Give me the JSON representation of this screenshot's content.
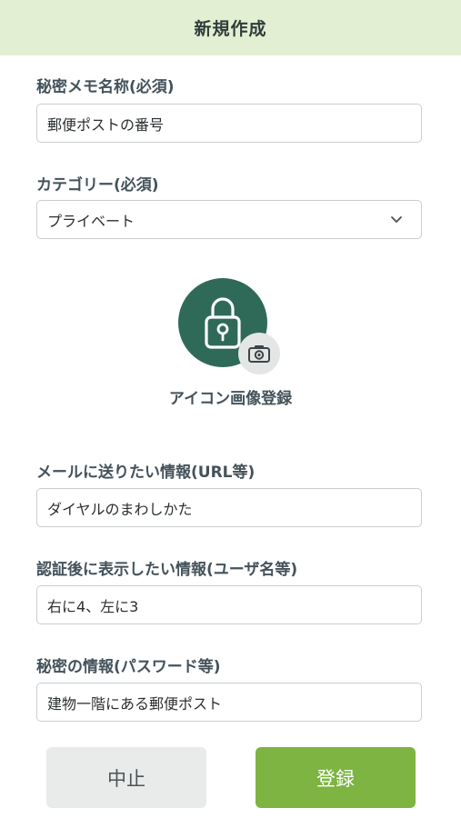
{
  "header": {
    "title": "新規作成",
    "background": "#e3efd2"
  },
  "form": {
    "memo_name": {
      "label": "秘密メモ名称(必須)",
      "value": "郵便ポストの番号"
    },
    "category": {
      "label": "カテゴリー(必須)",
      "selected": "プライベート",
      "icon": "chevron-down-icon"
    },
    "icon_register": {
      "caption": "アイコン画像登録",
      "icon": "lock-icon",
      "badge_icon": "camera-icon",
      "circle_color": "#2f6a58"
    },
    "mail_info": {
      "label": "メールに送りたい情報(URL等)",
      "value": "ダイヤルのまわしかた"
    },
    "after_auth_info": {
      "label": "認証後に表示したい情報(ユーザ名等)",
      "value": "右に4、左に3"
    },
    "secret_info": {
      "label": "秘密の情報(パスワード等)",
      "value": "建物一階にある郵便ポスト"
    }
  },
  "buttons": {
    "cancel_label": "中止",
    "register_label": "登録",
    "register_color": "#7db442"
  }
}
